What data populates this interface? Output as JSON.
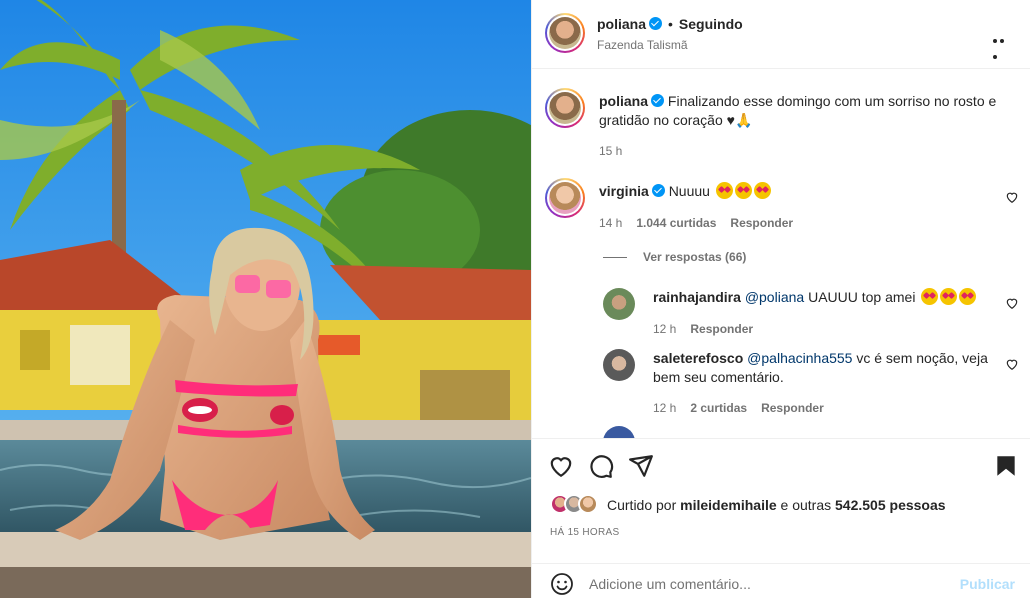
{
  "post": {
    "username": "poliana",
    "follow_status": "Seguindo",
    "location": "Fazenda Talismã",
    "caption": "Finalizando esse domingo com um sorriso no rosto e gratidão no coração ♥",
    "caption_time": "15 h"
  },
  "comments": [
    {
      "username": "virginia",
      "text": "Nuuuu",
      "time": "14 h",
      "likes": "1.044 curtidas",
      "reply": "Responder",
      "view_replies": "Ver respostas (66)"
    },
    {
      "username": "rainhajandira",
      "mention": "@poliana",
      "text": "UAUUU top amei",
      "time": "12 h",
      "reply": "Responder"
    },
    {
      "username": "saleterefosco",
      "mention": "@palhacinha555",
      "text": "vc é sem noção, veja bem seu comentário.",
      "time": "12 h",
      "likes": "2 curtidas",
      "reply": "Responder"
    }
  ],
  "footer": {
    "liked_prefix": "Curtido por",
    "liked_user": "mileidemihaile",
    "liked_suffix": "e outras",
    "liked_count": "542.505 pessoas",
    "time_ago": "HÁ 15 HORAS",
    "comment_placeholder": "Adicione um comentário...",
    "publish_label": "Publicar"
  },
  "colors": {
    "accent": "#0095f6",
    "publish_disabled": "#b2dffc",
    "secondary_text": "#737373"
  },
  "icons": [
    "heart-icon",
    "comment-icon",
    "share-icon",
    "bookmark-icon",
    "more-icon",
    "emoji-icon",
    "verified-icon"
  ]
}
